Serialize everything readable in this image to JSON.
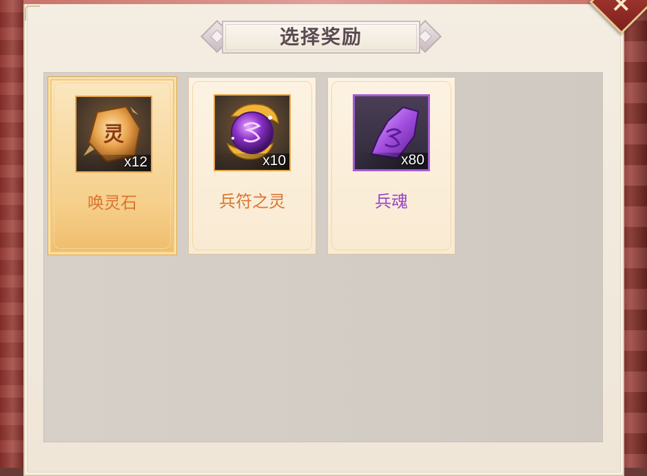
{
  "dialog": {
    "title": "选择奖励"
  },
  "items": [
    {
      "name": "唤灵石",
      "quantity": "x12",
      "rarity_color": "#d8752f",
      "frame": "gold",
      "icon": "rune-stone-icon",
      "selected": true
    },
    {
      "name": "兵符之灵",
      "quantity": "x10",
      "rarity_color": "#d8752f",
      "frame": "gold",
      "icon": "purple-orb-icon",
      "selected": false
    },
    {
      "name": "兵魂",
      "quantity": "x80",
      "rarity_color": "#9845c8",
      "frame": "purple",
      "icon": "purple-crystal-icon",
      "selected": false
    }
  ],
  "colors": {
    "selected_card": "#f6d08c",
    "panel_bg": "#f4ede2",
    "close_button": "#b5433b"
  }
}
